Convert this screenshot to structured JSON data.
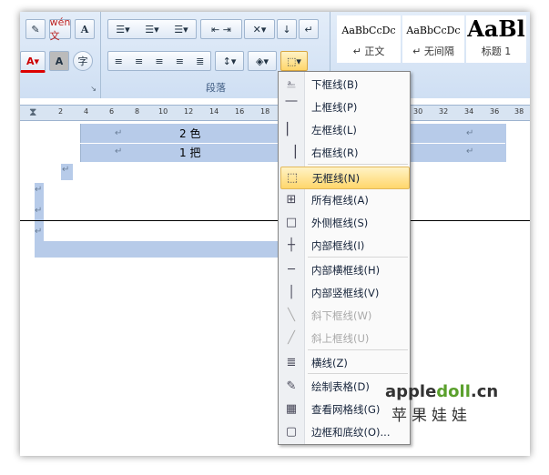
{
  "ribbon": {
    "group_label": "段落",
    "styles": [
      {
        "sample": "AaBbCcDc",
        "name": "↵ 正文"
      },
      {
        "sample": "AaBbCcDc",
        "name": "↵ 无间隔"
      },
      {
        "sample": "AaBl",
        "name": "标题 1"
      }
    ],
    "font_buttons": [
      "wén 文",
      "A",
      "A",
      "字"
    ]
  },
  "ruler": {
    "ticks": [
      "2",
      "4",
      "6",
      "8",
      "10",
      "12",
      "14",
      "16",
      "18",
      "30",
      "32",
      "34",
      "36",
      "38"
    ]
  },
  "document": {
    "rows": [
      {
        "num": "2",
        "text": "色"
      },
      {
        "num": "1",
        "text": "把"
      }
    ],
    "para_mark": "↵"
  },
  "menu": {
    "items": [
      {
        "icon": "bottom-border",
        "label": "下框线(B)",
        "state": "normal"
      },
      {
        "icon": "top-border",
        "label": "上框线(P)",
        "state": "normal"
      },
      {
        "icon": "left-border",
        "label": "左框线(L)",
        "state": "normal"
      },
      {
        "icon": "right-border",
        "label": "右框线(R)",
        "state": "normal"
      },
      {
        "icon": "no-border",
        "label": "无框线(N)",
        "state": "highlighted"
      },
      {
        "icon": "all-borders",
        "label": "所有框线(A)",
        "state": "normal"
      },
      {
        "icon": "outside-borders",
        "label": "外侧框线(S)",
        "state": "normal"
      },
      {
        "icon": "inside-borders",
        "label": "内部框线(I)",
        "state": "normal"
      },
      {
        "icon": "inside-horizontal",
        "label": "内部横框线(H)",
        "state": "normal"
      },
      {
        "icon": "inside-vertical",
        "label": "内部竖框线(V)",
        "state": "normal"
      },
      {
        "icon": "diagonal-down",
        "label": "斜下框线(W)",
        "state": "disabled"
      },
      {
        "icon": "diagonal-up",
        "label": "斜上框线(U)",
        "state": "disabled"
      },
      {
        "icon": "horizontal-line",
        "label": "横线(Z)",
        "state": "normal"
      },
      {
        "icon": "draw-table",
        "label": "绘制表格(D)",
        "state": "normal"
      },
      {
        "icon": "view-gridlines",
        "label": "查看网格线(G)",
        "state": "normal"
      },
      {
        "icon": "borders-shading",
        "label": "边框和底纹(O)...",
        "state": "normal"
      }
    ]
  },
  "watermark": {
    "brand": "appledoll.cn",
    "cn": "苹果娃娃"
  }
}
